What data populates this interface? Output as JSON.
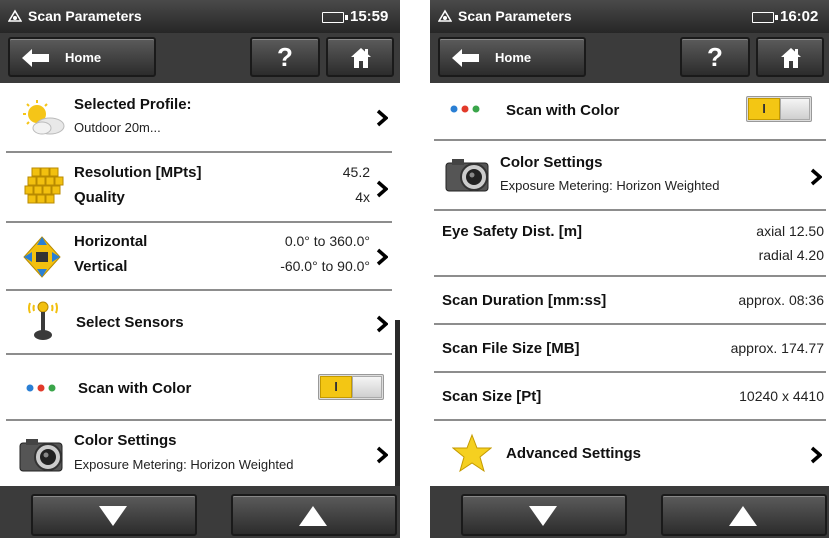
{
  "screen1": {
    "status": {
      "title": "Scan Parameters",
      "time": "15:59"
    },
    "toolbar": {
      "home_label": "Home",
      "help_label": "?"
    },
    "rows": {
      "profile": {
        "title": "Selected Profile:",
        "sub": "Outdoor 20m..."
      },
      "resolution": {
        "title1": "Resolution [MPts]",
        "val1": "45.2",
        "title2": "Quality",
        "val2": "4x"
      },
      "range": {
        "title1": "Horizontal",
        "val1": "0.0° to 360.0°",
        "title2": "Vertical",
        "val2": "-60.0° to 90.0°"
      },
      "sensors": {
        "title": "Select Sensors"
      },
      "color": {
        "title": "Scan with Color",
        "toggle_on": "I"
      },
      "color_settings": {
        "title": "Color Settings",
        "sub": "Exposure Metering: Horizon Weighted"
      }
    }
  },
  "screen2": {
    "status": {
      "title": "Scan Parameters",
      "time": "16:02"
    },
    "toolbar": {
      "home_label": "Home",
      "help_label": "?"
    },
    "rows": {
      "color": {
        "title": "Scan with Color",
        "toggle_on": "I"
      },
      "color_settings": {
        "title": "Color Settings",
        "sub": "Exposure Metering: Horizon Weighted"
      },
      "eye_safety": {
        "title": "Eye Safety Dist. [m]",
        "val1": "axial 12.50",
        "val2": "radial 4.20"
      },
      "duration": {
        "title": "Scan Duration [mm:ss]",
        "val": "approx. 08:36"
      },
      "file_size": {
        "title": "Scan File Size [MB]",
        "val": "approx. 174.77"
      },
      "scan_size": {
        "title": "Scan Size [Pt]",
        "val": "10240 x 4410"
      },
      "advanced": {
        "title": "Advanced Settings"
      }
    }
  },
  "colors": {
    "accent_toggle": "#f3c614",
    "dot_blue": "#2a7fd4",
    "dot_red": "#e23a2a",
    "dot_green": "#3aa54a"
  },
  "icons": [
    "logo-icon",
    "battery-icon",
    "back-arrow-icon",
    "help-icon",
    "house-icon",
    "weather-icon",
    "resolution-grid-icon",
    "direction-icon",
    "sensor-icon",
    "color-dots-icon",
    "camera-icon",
    "star-icon",
    "chevron-right-icon",
    "arrow-down-icon",
    "arrow-up-icon"
  ]
}
